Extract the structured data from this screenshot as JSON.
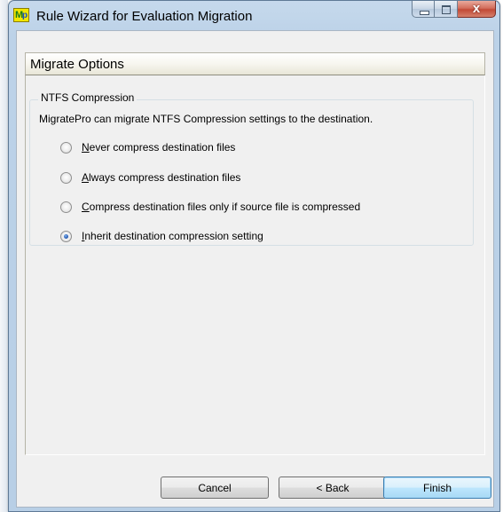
{
  "window": {
    "title": "Rule Wizard for Evaluation Migration",
    "app_icon_letters": "Mp",
    "close_glyph": "x"
  },
  "page": {
    "header": "Migrate Options"
  },
  "ntfs_group": {
    "legend": "NTFS Compression",
    "description": "MigratePro can migrate NTFS Compression settings to the destination.",
    "options": [
      {
        "mnemonic": "N",
        "rest": "ever compress destination files",
        "checked": false
      },
      {
        "mnemonic": "A",
        "rest": "lways compress destination files",
        "checked": false
      },
      {
        "mnemonic": "C",
        "rest": "ompress destination files only if source file is compressed",
        "checked": false
      },
      {
        "mnemonic": "I",
        "rest": "nherit destination compression setting",
        "checked": true
      }
    ]
  },
  "buttons": {
    "cancel": "Cancel",
    "back": "< Back",
    "finish": "Finish"
  }
}
